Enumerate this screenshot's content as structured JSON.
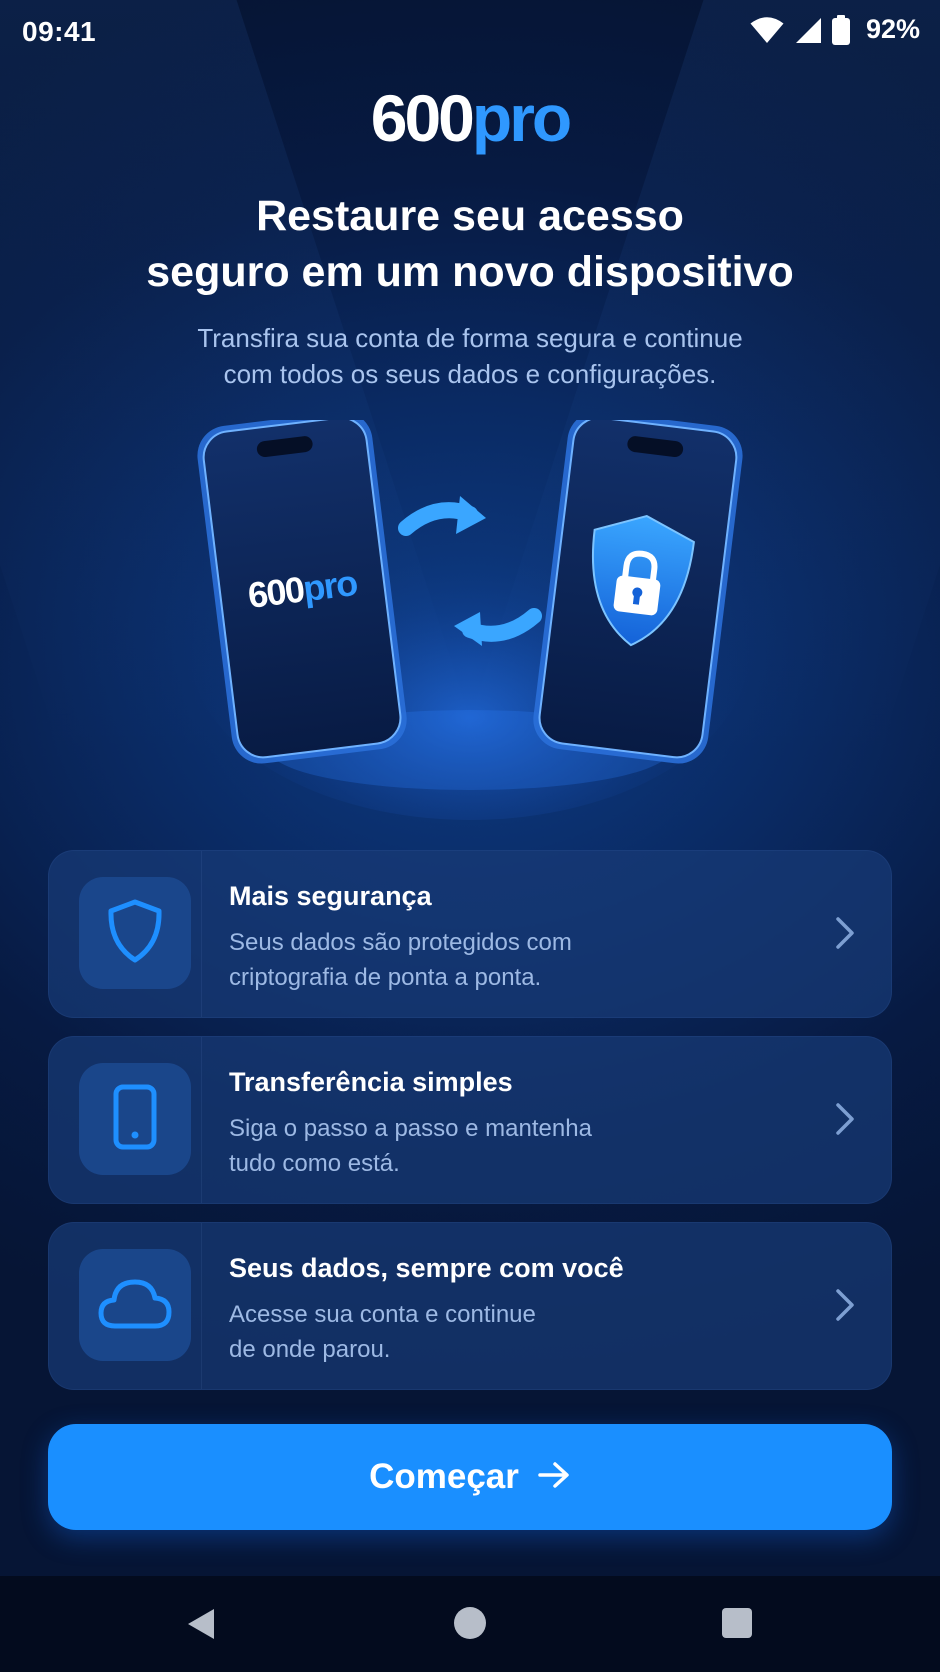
{
  "status_bar": {
    "time": "09:41",
    "battery_percent": "92%",
    "icons": [
      "wifi-icon",
      "cellular-signal-icon",
      "battery-icon"
    ]
  },
  "logo": {
    "part1": "600",
    "part2": "pro"
  },
  "headline": {
    "line1": "Restaure seu acesso",
    "line2": "seguro em um novo dispositivo"
  },
  "subtitle": {
    "line1": "Transfira sua conta de forma segura e continue",
    "line2": "com todos os seus dados e configurações."
  },
  "hero": {
    "phone_logo_part1": "600",
    "phone_logo_part2": "pro",
    "icons": [
      "sync-arrows-icon",
      "shield-lock-icon"
    ]
  },
  "features": [
    {
      "icon": "shield-icon",
      "title": "Mais segurança",
      "desc_line1": "Seus dados são protegidos com",
      "desc_line2": "criptografia de ponta a ponta."
    },
    {
      "icon": "smartphone-icon",
      "title": "Transferência simples",
      "desc_line1": "Siga o passo a passo e mantenha",
      "desc_line2": "tudo como está."
    },
    {
      "icon": "cloud-icon",
      "title": "Seus dados, sempre com você",
      "desc_line1": "Acesse sua conta e continue",
      "desc_line2": "de onde parou."
    }
  ],
  "cta": {
    "label": "Começar",
    "icon": "arrow-right-icon"
  },
  "nav_bar": {
    "icons": [
      "back-icon",
      "home-icon",
      "recents-icon"
    ]
  },
  "colors": {
    "accent": "#1a8fff",
    "logo_accent": "#2f98ff",
    "background": "#0a2a63",
    "card": "#173a76",
    "secondary_text": "#9db9e4"
  }
}
